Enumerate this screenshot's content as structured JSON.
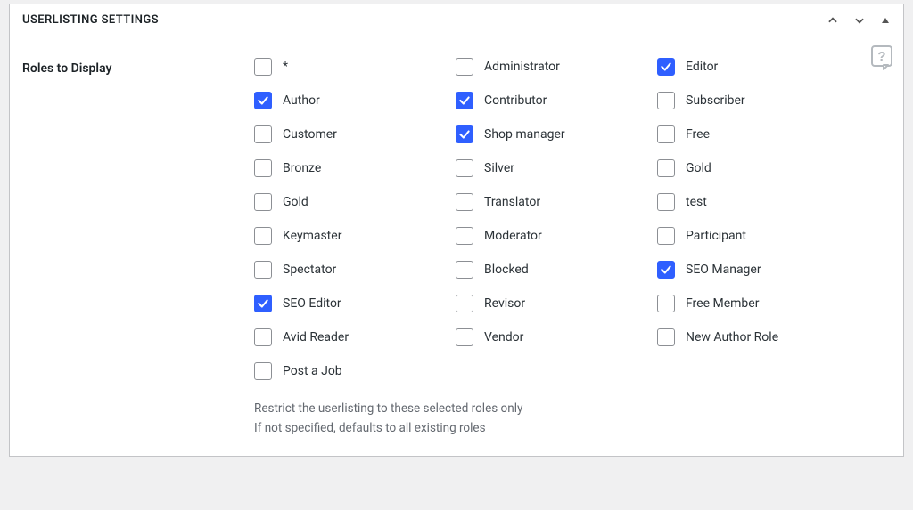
{
  "panel": {
    "title": "USERLISTING SETTINGS"
  },
  "field": {
    "label": "Roles to Display",
    "desc1": "Restrict the userlisting to these selected roles only",
    "desc2": "If not specified, defaults to all existing roles"
  },
  "roles": {
    "col1": [
      {
        "label": "*",
        "checked": false
      },
      {
        "label": "Author",
        "checked": true
      },
      {
        "label": "Customer",
        "checked": false
      },
      {
        "label": "Bronze",
        "checked": false
      },
      {
        "label": "Gold",
        "checked": false
      },
      {
        "label": "Keymaster",
        "checked": false
      },
      {
        "label": "Spectator",
        "checked": false
      },
      {
        "label": "SEO Editor",
        "checked": true
      },
      {
        "label": "Avid Reader",
        "checked": false
      },
      {
        "label": "Post a Job",
        "checked": false
      }
    ],
    "col2": [
      {
        "label": "Administrator",
        "checked": false
      },
      {
        "label": "Contributor",
        "checked": true
      },
      {
        "label": "Shop manager",
        "checked": true
      },
      {
        "label": "Silver",
        "checked": false
      },
      {
        "label": "Translator",
        "checked": false
      },
      {
        "label": "Moderator",
        "checked": false
      },
      {
        "label": "Blocked",
        "checked": false
      },
      {
        "label": "Revisor",
        "checked": false
      },
      {
        "label": "Vendor",
        "checked": false
      }
    ],
    "col3": [
      {
        "label": "Editor",
        "checked": true
      },
      {
        "label": "Subscriber",
        "checked": false
      },
      {
        "label": "Free",
        "checked": false
      },
      {
        "label": "Gold",
        "checked": false
      },
      {
        "label": "test",
        "checked": false
      },
      {
        "label": "Participant",
        "checked": false
      },
      {
        "label": "SEO Manager",
        "checked": true
      },
      {
        "label": "Free Member",
        "checked": false
      },
      {
        "label": "New Author Role",
        "checked": false
      }
    ]
  }
}
